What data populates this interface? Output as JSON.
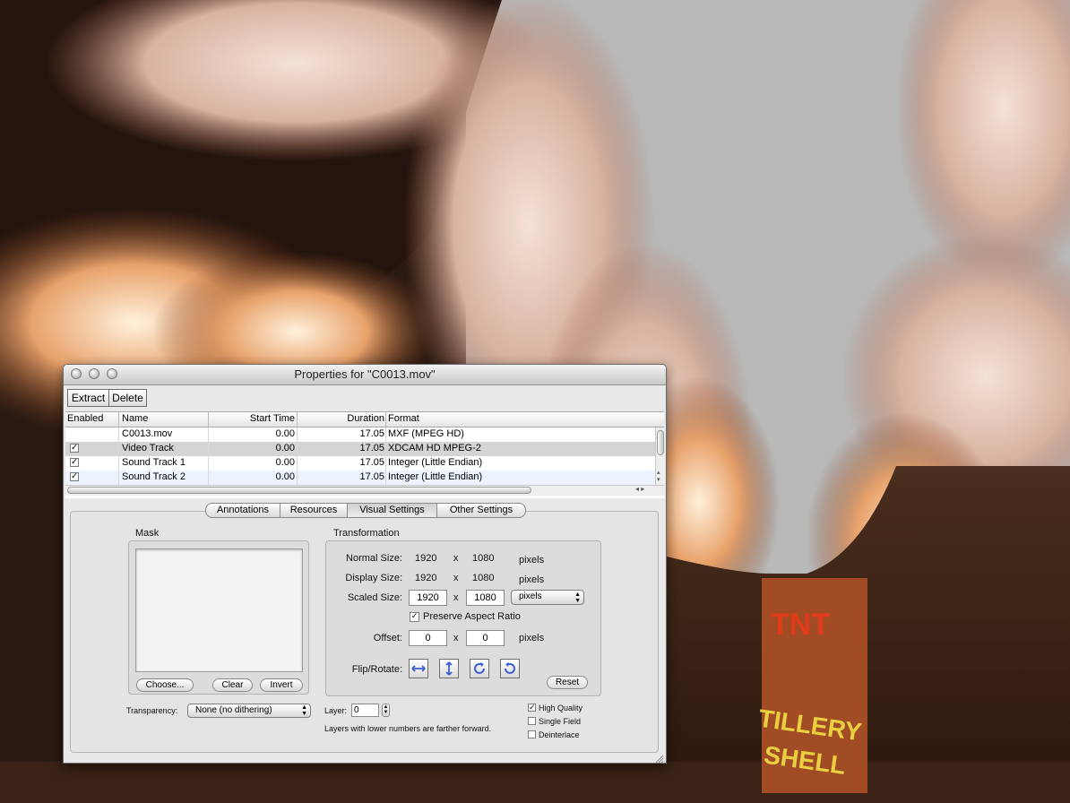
{
  "window": {
    "title": "Properties for \"C0013.mov\""
  },
  "toolbar": {
    "extract_label": "Extract",
    "delete_label": "Delete"
  },
  "tracks": {
    "headers": [
      "Enabled",
      "Name",
      "Start Time",
      "Duration",
      "Format"
    ],
    "rows": [
      {
        "enabled": false,
        "name": "C0013.mov",
        "start": "0.00",
        "duration": "17.05",
        "format": "MXF (MPEG HD)"
      },
      {
        "enabled": true,
        "name": "Video Track",
        "start": "0.00",
        "duration": "17.05",
        "format": "XDCAM HD MPEG-2"
      },
      {
        "enabled": true,
        "name": "Sound Track 1",
        "start": "0.00",
        "duration": "17.05",
        "format": "Integer (Little Endian)"
      },
      {
        "enabled": true,
        "name": "Sound Track 2",
        "start": "0.00",
        "duration": "17.05",
        "format": "Integer (Little Endian)"
      }
    ],
    "selected_row": 1
  },
  "tabs": [
    "Annotations",
    "Resources",
    "Visual Settings",
    "Other Settings"
  ],
  "active_tab": "Visual Settings",
  "mask": {
    "title": "Mask",
    "choose_label": "Choose...",
    "clear_label": "Clear",
    "invert_label": "Invert"
  },
  "transformation": {
    "title": "Transformation",
    "normal_label": "Normal Size:",
    "normal_w": "1920",
    "normal_h": "1080",
    "display_label": "Display Size:",
    "display_w": "1920",
    "display_h": "1080",
    "scaled_label": "Scaled Size:",
    "scaled_w": "1920",
    "scaled_h": "1080",
    "times": "x",
    "units": "pixels",
    "units_popup": "pixels",
    "preserve_label": "Preserve Aspect Ratio",
    "preserve_checked": true,
    "offset_label": "Offset:",
    "offset_x": "0",
    "offset_y": "0",
    "flip_label": "Flip/Rotate:",
    "reset_label": "Reset"
  },
  "transparency": {
    "label": "Transparency:",
    "value": "None (no dithering)"
  },
  "layer": {
    "label": "Layer:",
    "value": "0",
    "hint": "Layers with lower numbers are farther forward."
  },
  "options": {
    "high_quality": {
      "label": "High Quality",
      "checked": true
    },
    "single_field": {
      "label": "Single Field",
      "checked": false
    },
    "deinterlace": {
      "label": "Deinterlace",
      "checked": false
    }
  },
  "colors": {
    "selected_row": "#d4d4d4",
    "alt_row": "#edf3fe",
    "accent": "#3b5fcf"
  }
}
